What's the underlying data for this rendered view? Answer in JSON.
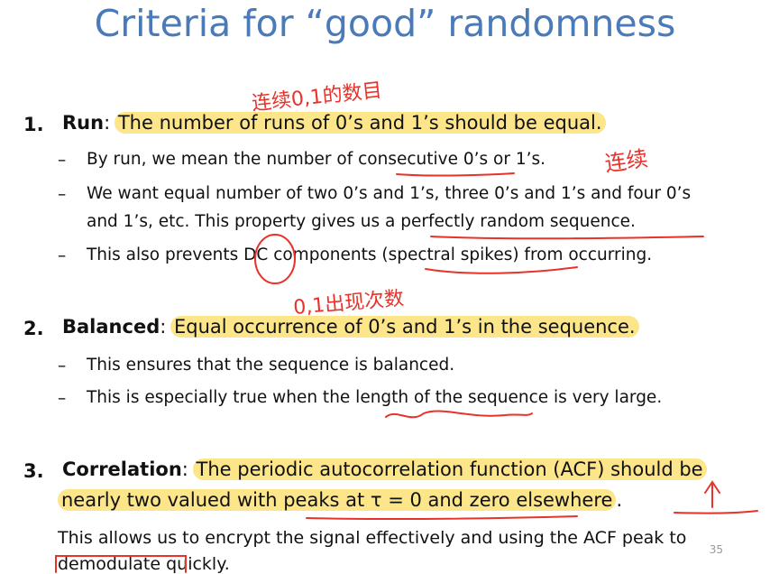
{
  "title": "Criteria for “good” randomness",
  "items": [
    {
      "number": "1.",
      "term": "Run",
      "sep": ": ",
      "highlight": "The number of runs of 0’s and 1’s should be equal.",
      "bullets": [
        "By run, we mean the number of consecutive 0’s or 1’s.",
        "We want equal number of two 0’s and 1’s, three 0’s and 1’s and four 0’s",
        "and 1’s, etc. This property gives us a perfectly random sequence.",
        "This also prevents DC components (spectral spikes) from occurring."
      ]
    },
    {
      "number": "2.",
      "term": "Balanced",
      "sep": ": ",
      "highlight": "Equal occurrence of 0’s and 1’s in the sequence.",
      "bullets": [
        "This ensures that the sequence is balanced.",
        "This is especially true when the length of the sequence is very large."
      ]
    },
    {
      "number": "3.",
      "term": "Correlation",
      "sep": ": ",
      "highlight": "The periodic autocorrelation function (ACF) should be",
      "highlight2": "nearly two valued with peaks at τ = 0 and zero elsewhere",
      "tail": ".",
      "plain1": "This allows us to encrypt the signal effectively and using the ACF peak to",
      "plain2": "demodulate quickly."
    }
  ],
  "dash": "–",
  "slide_number": "35",
  "annotations": {
    "note1": "连续0,1的数目",
    "note2": "连续",
    "note3": "0,1出现次数",
    "ink_color": "#e8322a"
  }
}
